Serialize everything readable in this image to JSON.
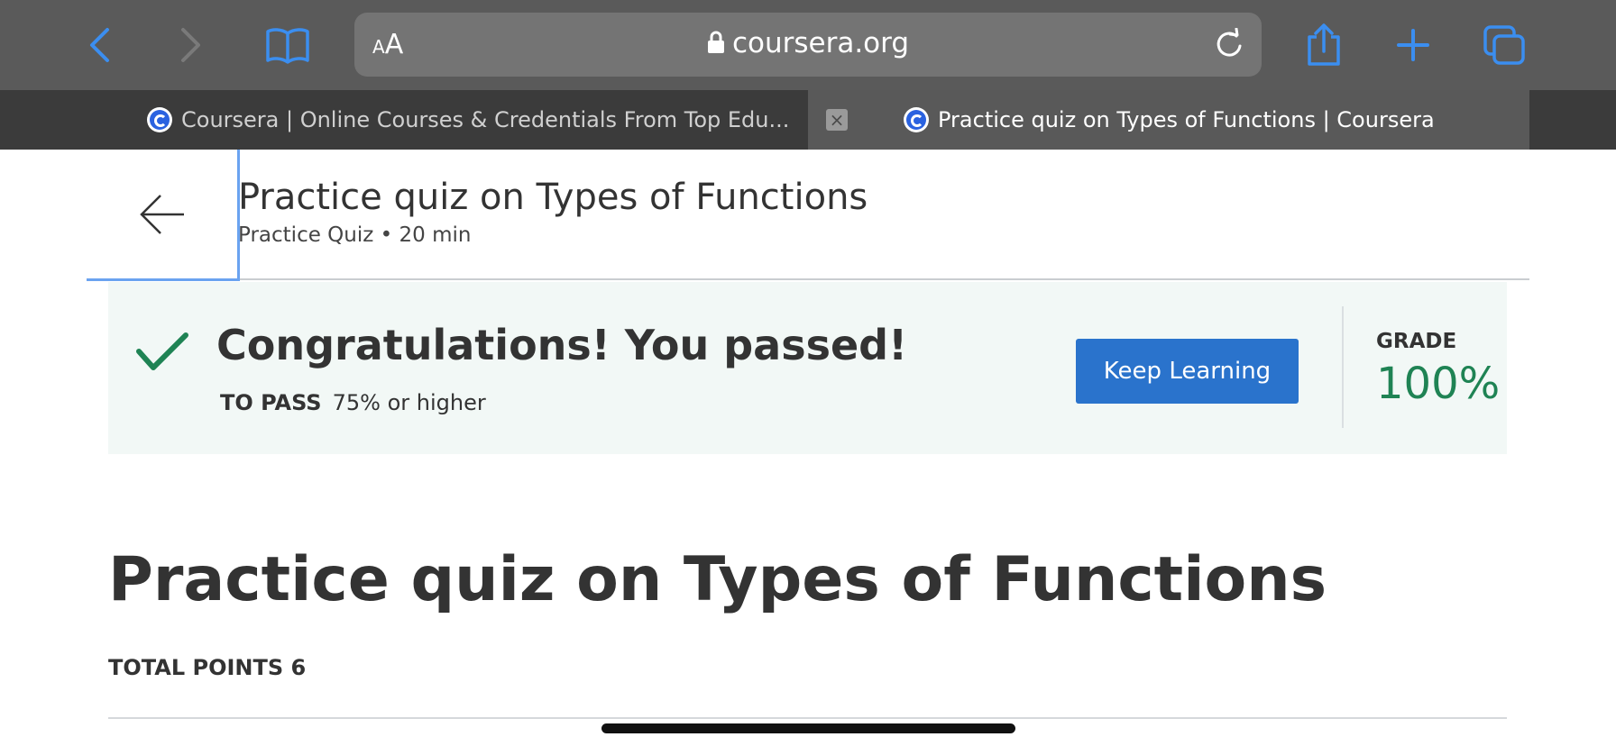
{
  "browser": {
    "address_bar": {
      "text_size_small": "A",
      "text_size_large": "A",
      "url": "coursera.org"
    },
    "tabs": [
      {
        "title": "Coursera | Online Courses & Credentials From Top Edu...",
        "active": false
      },
      {
        "title": "Practice quiz on Types of Functions | Coursera",
        "active": true
      }
    ],
    "tab_close_glyph": "×",
    "icons": [
      "back-icon",
      "forward-icon",
      "bookmarks-icon",
      "lock-icon",
      "reload-icon",
      "share-icon",
      "new-tab-icon",
      "tabs-overview-icon"
    ],
    "accent_color": "#3b8ef0"
  },
  "header": {
    "title": "Practice quiz on Types of Functions",
    "subtitle": "Practice Quiz • 20 min"
  },
  "banner": {
    "message": "Congratulations! You passed!",
    "to_pass_label": "TO PASS",
    "to_pass_value": "75% or higher",
    "button_label": "Keep Learning",
    "grade_label": "GRADE",
    "grade_value": "100%",
    "success_color": "#1f8354",
    "button_color": "#2a73cc"
  },
  "main": {
    "title": "Practice quiz on Types of Functions",
    "total_points": "TOTAL POINTS 6"
  }
}
